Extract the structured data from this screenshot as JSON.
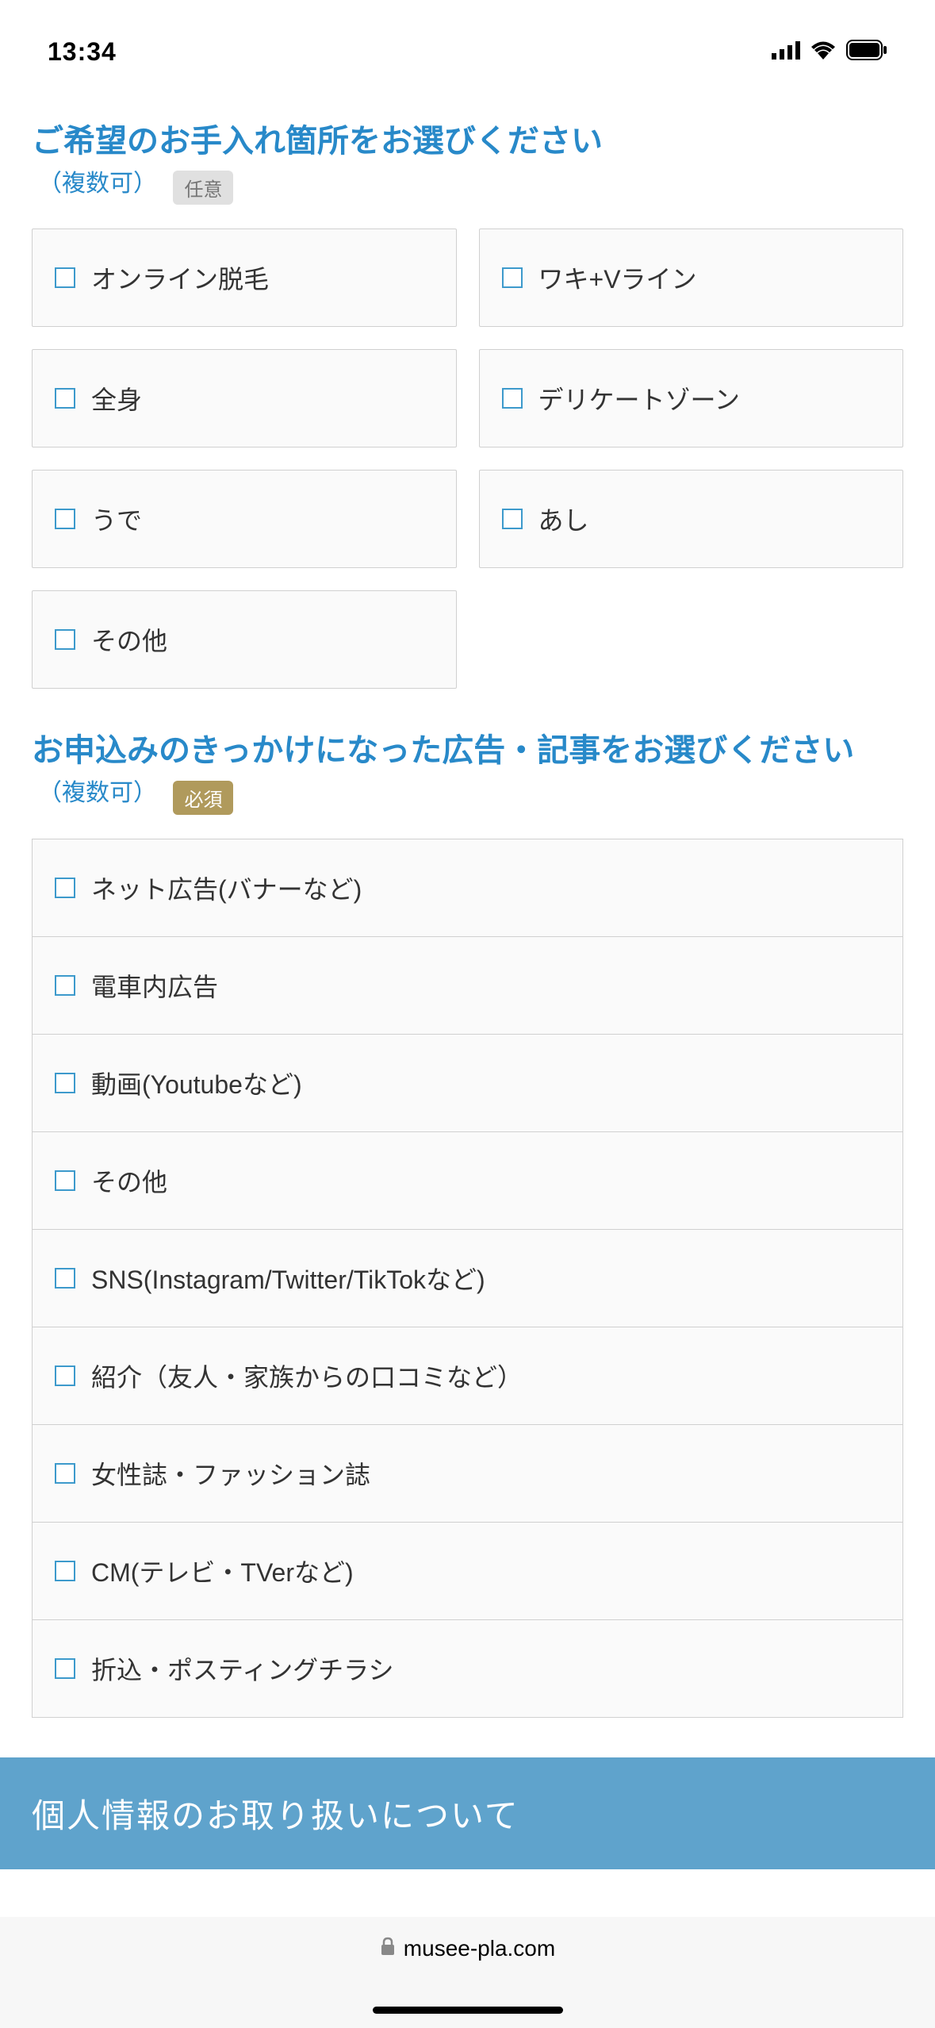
{
  "status_bar": {
    "time": "13:34"
  },
  "section1": {
    "title": "ご希望のお手入れ箇所をお選びください",
    "subtitle": "（複数可）",
    "badge": "任意",
    "options": [
      "オンライン脱毛",
      "ワキ+Vライン",
      "全身",
      "デリケートゾーン",
      "うで",
      "あし",
      "その他"
    ]
  },
  "section2": {
    "title": "お申込みのきっかけになった広告・記事をお選びください",
    "subtitle": "（複数可）",
    "badge": "必須",
    "options": [
      "ネット広告(バナーなど)",
      "電車内広告",
      "動画(Youtubeなど)",
      "その他",
      "SNS(Instagram/Twitter/TikTokなど)",
      "紹介（友人・家族からの口コミなど）",
      "女性誌・ファッション誌",
      "CM(テレビ・TVerなど)",
      "折込・ポスティングチラシ"
    ]
  },
  "privacy": {
    "title": "個人情報のお取り扱いについて"
  },
  "bottom_bar": {
    "url": "musee-pla.com"
  }
}
